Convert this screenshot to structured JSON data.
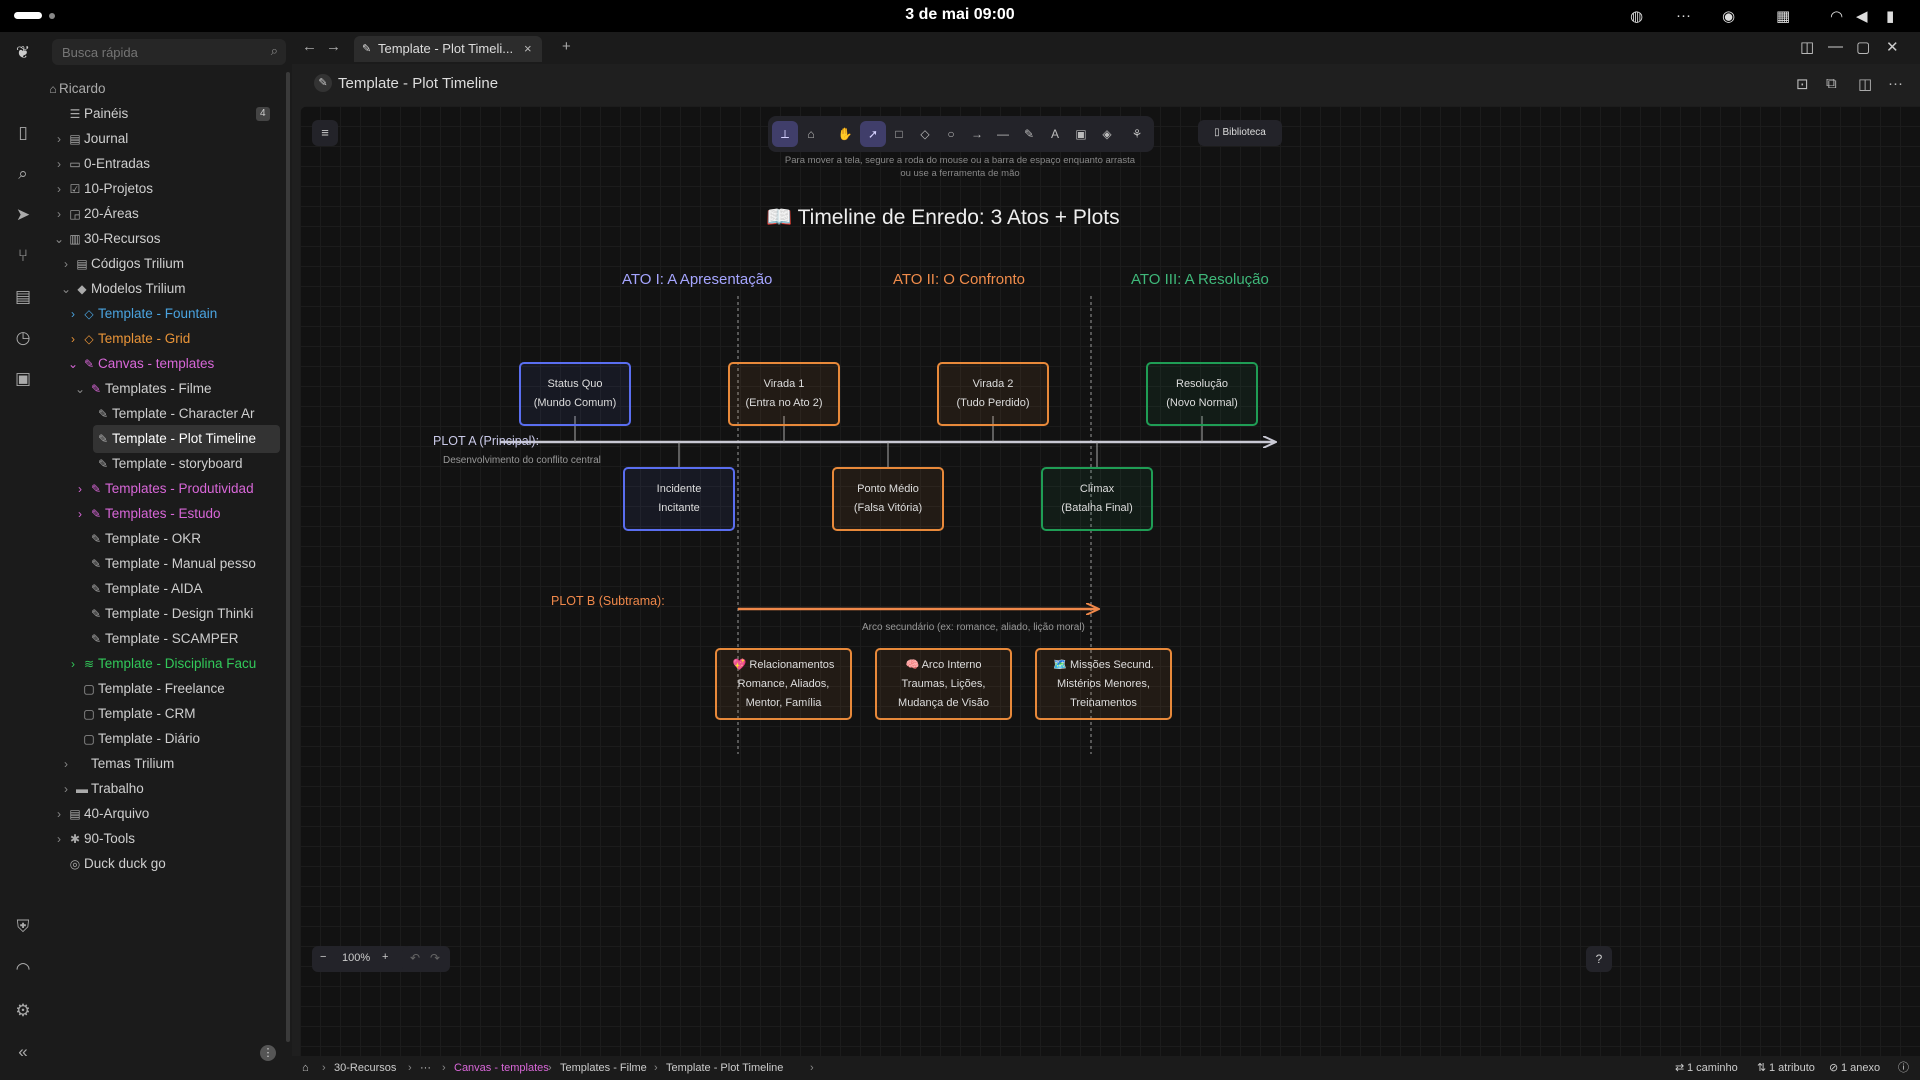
{
  "system": {
    "clock": "3 de mai  09:00",
    "tray_icons": [
      "globe-icon",
      "more-icon",
      "circle-icon",
      "grid-icon",
      "wifi-icon",
      "volume-icon",
      "battery-icon"
    ]
  },
  "sidebar": {
    "search_placeholder": "Busca rápida",
    "root": "Ricardo",
    "items": [
      {
        "label": "Painéis",
        "badge": "4"
      },
      {
        "label": "Journal"
      },
      {
        "label": "0-Entradas"
      },
      {
        "label": "10-Projetos"
      },
      {
        "label": "20-Áreas"
      },
      {
        "label": "30-Recursos"
      },
      {
        "label": "Códigos Trilium"
      },
      {
        "label": "Modelos Trilium"
      },
      {
        "label": "Template - Fountain",
        "color": "#4aa3df"
      },
      {
        "label": "Template - Grid",
        "color": "#e99438"
      },
      {
        "label": "Canvas - templates",
        "color": "#d867d8"
      },
      {
        "label": "Templates - Filme"
      },
      {
        "label": "Template - Character Ar"
      },
      {
        "label": "Template - Plot Timeline"
      },
      {
        "label": "Template - storyboard"
      },
      {
        "label": "Templates - Produtividad",
        "color": "#d867d8"
      },
      {
        "label": "Templates - Estudo",
        "color": "#d867d8"
      },
      {
        "label": "Template - OKR"
      },
      {
        "label": "Template - Manual pesso"
      },
      {
        "label": "Template - AIDA"
      },
      {
        "label": "Template - Design Thinki"
      },
      {
        "label": "Template - SCAMPER"
      },
      {
        "label": "Template - Disciplina Facu",
        "color": "#32c95a"
      },
      {
        "label": "Template - Freelance"
      },
      {
        "label": "Template - CRM"
      },
      {
        "label": "Template - Diário"
      },
      {
        "label": "Temas Trilium"
      },
      {
        "label": "Trabalho"
      },
      {
        "label": "40-Arquivo"
      },
      {
        "label": "90-Tools"
      },
      {
        "label": "Duck duck go"
      }
    ]
  },
  "tabs": {
    "active_label": "Template - Plot Timeli...",
    "close": "×",
    "new": "+"
  },
  "note": {
    "title": "Template - Plot Timeline"
  },
  "canvas": {
    "library_label": "Biblioteca",
    "hint": "Para mover a tela, segure a roda do mouse ou a barra de espaço enquanto arrasta ou use a ferramenta de mão",
    "zoom": "100%",
    "zoom_minus": "−",
    "zoom_plus": "+",
    "help": "?"
  },
  "diagram": {
    "title": "📖 Timeline de Enredo: 3 Atos + Plots",
    "acts": [
      {
        "label": "ATO I: A Apresentação",
        "color": "#a5a5ff"
      },
      {
        "label": "ATO II: O Confronto",
        "color": "#f08c4b"
      },
      {
        "label": "ATO III: A Resolução",
        "color": "#3fb87a"
      }
    ],
    "plot_a": {
      "label": "PLOT A (Principal):",
      "sub": "Desenvolvimento do conflito central"
    },
    "plot_b": {
      "label": "PLOT B (Subtrama):",
      "sub": "Arco secundário (ex: romance, aliado, lição moral)"
    },
    "top_boxes": [
      {
        "line1": "Status Quo",
        "line2": "(Mundo Comum)",
        "color": "#5a6ef0"
      },
      {
        "line1": "Virada 1",
        "line2": "(Entra no Ato 2)",
        "color": "#e8893a"
      },
      {
        "line1": "Virada 2",
        "line2": "(Tudo Perdido)",
        "color": "#e8893a"
      },
      {
        "line1": "Resolução",
        "line2": "(Novo Normal)",
        "color": "#1f9d55"
      }
    ],
    "bottom_boxes": [
      {
        "line1": "Incidente",
        "line2": "Incitante",
        "color": "#5a6ef0"
      },
      {
        "line1": "Ponto Médio",
        "line2": "(Falsa Vitória)",
        "color": "#e8893a"
      },
      {
        "line1": "Clímax",
        "line2": "(Batalha Final)",
        "color": "#1f9d55"
      }
    ],
    "subplot_boxes": [
      {
        "line1": "💖 Relacionamentos",
        "line2": "Romance, Aliados,",
        "line3": "Mentor, Família",
        "color": "#e8893a"
      },
      {
        "line1": "🧠 Arco Interno",
        "line2": "Traumas, Lições,",
        "line3": "Mudança de Visão",
        "color": "#e8893a"
      },
      {
        "line1": "🗺️ Missões Secund.",
        "line2": "Mistérios Menores,",
        "line3": "Treinamentos",
        "color": "#e8893a"
      }
    ]
  },
  "statusbar": {
    "crumbs": [
      "30-Recursos",
      "···",
      "Canvas - templates",
      "Templates - Filme",
      "Template - Plot Timeline"
    ],
    "paths": "1 caminho",
    "attrs": "1 atributo",
    "attachments": "1 anexo"
  }
}
